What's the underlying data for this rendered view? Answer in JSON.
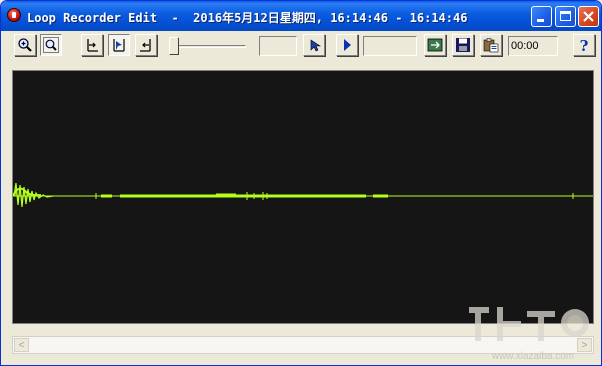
{
  "window": {
    "title": "Loop Recorder Edit  -  2016年5月12日星期四, 16:14:46 - 16:14:46",
    "caption_buttons": {
      "minimize": "minimize-button",
      "maximize": "maximize-button",
      "close": "close-button"
    }
  },
  "toolbar": {
    "time_display": "00:00",
    "position_field": "",
    "range_field": "",
    "buttons": [
      {
        "name": "zoom-in-button",
        "icon": "magnifier-plus-icon"
      },
      {
        "name": "zoom-fit-button",
        "icon": "magnifier-select-icon"
      },
      {
        "name": "mark-start-button",
        "icon": "mark-start-icon"
      },
      {
        "name": "select-button",
        "icon": "select-icon"
      },
      {
        "name": "mark-end-button",
        "icon": "mark-end-icon"
      },
      {
        "name": "cursor-button",
        "icon": "cursor-icon"
      },
      {
        "name": "play-button",
        "icon": "play-icon"
      },
      {
        "name": "convert-button",
        "icon": "convert-icon"
      },
      {
        "name": "save-button",
        "icon": "floppy-disk-icon"
      },
      {
        "name": "paste-button",
        "icon": "clipboard-icon"
      },
      {
        "name": "help-button",
        "icon": "question-mark-icon"
      }
    ],
    "volume_slider": {
      "level": 0.0
    }
  },
  "colors": {
    "waveform": "#b4ff1e",
    "wave_background": "#151515",
    "titlebar": "#0552d6"
  },
  "watermark": {
    "text": "www.xiazaiba.com"
  }
}
